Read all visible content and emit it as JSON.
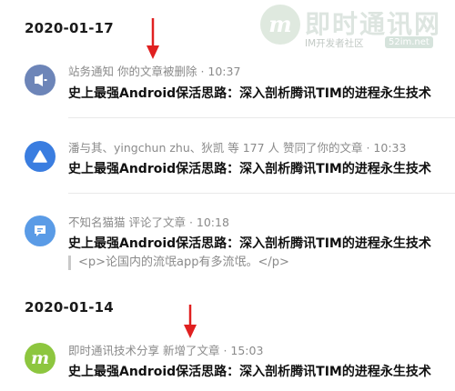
{
  "watermark": {
    "main_text": "即时通讯网",
    "sub_text": "IM开发者社区",
    "url_text": "52im.net"
  },
  "groups": [
    {
      "date": "2020-01-17",
      "items": [
        {
          "icon": "speaker-icon",
          "icon_color": "#6d85b8",
          "meta": "站务通知 你的文章被删除 · 10:37",
          "title": "史上最强Android保活思路：深入剖析腾讯TIM的进程永生技术"
        },
        {
          "icon": "upvote-triangle-icon",
          "icon_color": "#3a7de0",
          "meta": "潘与其、yingchun zhu、狄凯 等 177 人 赞同了你的文章 · 10:33",
          "title": "史上最强Android保活思路：深入剖析腾讯TIM的进程永生技术"
        },
        {
          "icon": "comment-icon",
          "icon_color": "#5a9be6",
          "meta": "不知名猫猫 评论了文章 · 10:18",
          "title": "史上最强Android保活思路：深入剖析腾讯TIM的进程永生技术",
          "quote": "<p>论国内的流氓app有多流氓。</p>"
        }
      ]
    },
    {
      "date": "2020-01-14",
      "items": [
        {
          "icon": "m-logo-icon",
          "icon_color": "#8dc63f",
          "meta": "即时通讯技术分享 新增了文章 · 15:03",
          "title": "史上最强Android保活思路：深入剖析腾讯TIM的进程永生技术"
        }
      ]
    }
  ],
  "colors": {
    "arrow": "#e02020",
    "meta_text": "#8a8a8a",
    "divider": "#e9e9e9"
  }
}
